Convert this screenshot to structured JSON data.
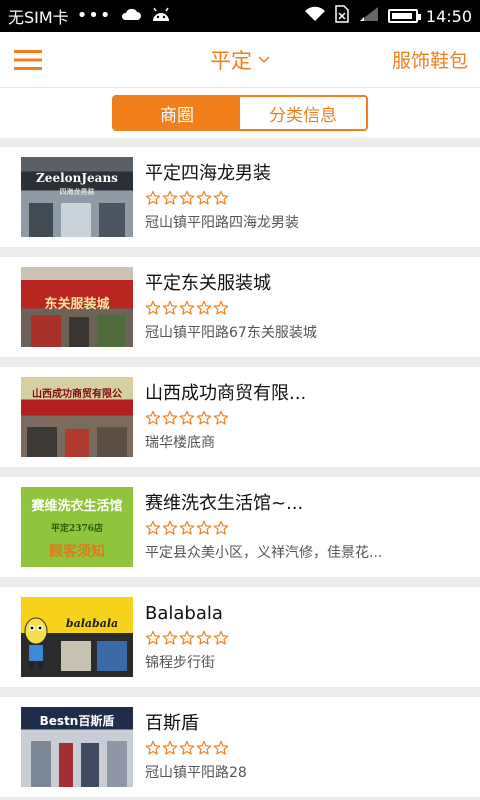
{
  "status_bar": {
    "carrier": "无SIM卡",
    "dots": "•••",
    "time": "14:50",
    "battery_level": 0.9
  },
  "header": {
    "city": "平定",
    "category": "服饰鞋包"
  },
  "tabs": [
    {
      "label": "商圈",
      "active": true
    },
    {
      "label": "分类信息",
      "active": false
    }
  ],
  "colors": {
    "accent": "#f07f1c"
  },
  "shops": [
    {
      "name": "平定四海龙男装",
      "rating": 0,
      "address": "冠山镇平阳路四海龙男装",
      "sign_text": "ZeelonJeans",
      "sign_sub": "四海龙男装"
    },
    {
      "name": "平定东关服装城",
      "rating": 0,
      "address": "冠山镇平阳路67东关服装城",
      "sign_text": "东关服装城"
    },
    {
      "name": "山西成功商贸有限...",
      "rating": 0,
      "address": "瑞华楼底商",
      "sign_text": "山西成功商贸有限公"
    },
    {
      "name": "赛维洗衣生活馆~...",
      "rating": 0,
      "address": "平定县众美小区，义祥汽修，佳景花...",
      "sign_text": "赛维洗衣生活馆",
      "sign_sub": "平定2376店",
      "sign_sub2": "顾客须知"
    },
    {
      "name": "Balabala",
      "rating": 0,
      "address": "锦程步行街",
      "sign_text": "balabala"
    },
    {
      "name": "百斯盾",
      "rating": 0,
      "address": "冠山镇平阳路28",
      "sign_text": "Bestn百斯盾"
    }
  ]
}
